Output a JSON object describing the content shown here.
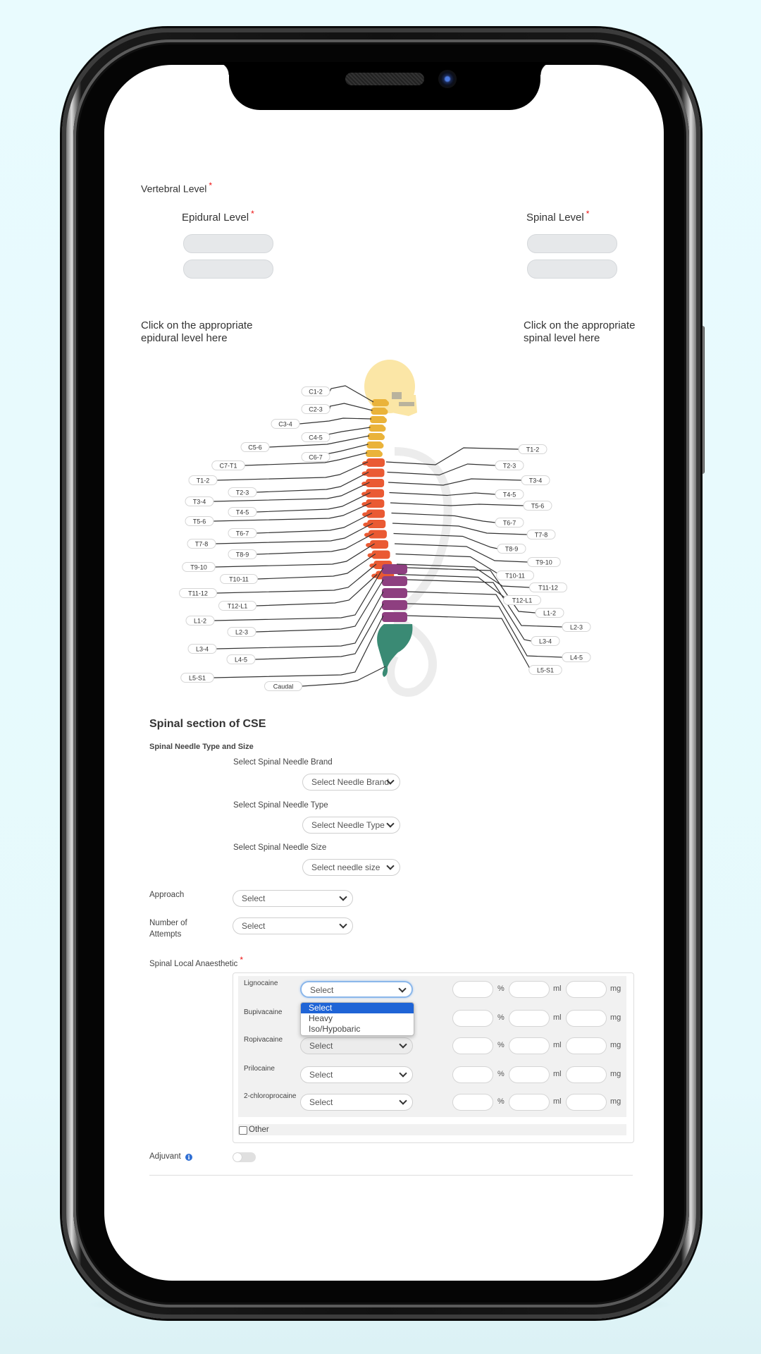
{
  "vertebral_level": {
    "label": "Vertebral Level",
    "required_mark": "*",
    "epidural": {
      "label": "Epidural Level",
      "required_mark": "*",
      "values": [
        "",
        ""
      ]
    },
    "spinal": {
      "label": "Spinal Level",
      "required_mark": "*",
      "values": [
        "",
        ""
      ]
    },
    "epidural_help": [
      "Click on the appropriate",
      "epidural level here"
    ],
    "spinal_help": [
      "Click on the appropriate",
      "spinal level here"
    ]
  },
  "spine_diagram": {
    "left_labels": [
      "C1-2",
      "C2-3",
      "C3-4",
      "C4-5",
      "C5-6",
      "C6-7",
      "C7-T1",
      "T1-2",
      "T2-3",
      "T3-4",
      "T4-5",
      "T5-6",
      "T6-7",
      "T7-8",
      "T8-9",
      "T9-10",
      "T10-11",
      "T11-12",
      "T12-L1",
      "L1-2",
      "L2-3",
      "L3-4",
      "L4-5",
      "L5-S1",
      "Caudal"
    ],
    "right_labels": [
      "T1-2",
      "T2-3",
      "T3-4",
      "T4-5",
      "T5-6",
      "T6-7",
      "T7-8",
      "T8-9",
      "T9-10",
      "T10-11",
      "T11-12",
      "T12-L1",
      "L1-2",
      "L2-3",
      "L3-4",
      "L4-5",
      "L5-S1"
    ],
    "colors": {
      "skull": "#fbe6a6",
      "jaw": "#b9b39d",
      "cervical": "#eab33a",
      "thoracic": "#ea5a33",
      "lumbar": "#8e3f80",
      "sacrum": "#3a8a74",
      "ribcage": "#ececec"
    }
  },
  "spinal_section": {
    "title": "Spinal section of CSE",
    "needle_group_label": "Spinal Needle Type and Size",
    "brand": {
      "label": "Select Spinal Needle Brand",
      "value": "Select Needle Brand"
    },
    "type": {
      "label": "Select Spinal Needle Type",
      "value": "Select Needle Type"
    },
    "size": {
      "label": "Select Spinal Needle Size",
      "value": "Select needle size"
    },
    "approach": {
      "label": "Approach",
      "value": "Select"
    },
    "attempts": {
      "label_line1": "Number of",
      "label_line2": "Attempts",
      "value": "Select"
    },
    "local_anaesthetic": {
      "label": "Spinal Local Anaesthetic",
      "required_mark": "*",
      "rows": [
        {
          "drug": "Lignocaine",
          "value": "Select",
          "percent": "",
          "ml": "",
          "mg": ""
        },
        {
          "drug": "Bupivacaine",
          "value": "Select",
          "percent": "",
          "ml": "",
          "mg": ""
        },
        {
          "drug": "Ropivacaine",
          "value": "Select",
          "percent": "",
          "ml": "",
          "mg": ""
        },
        {
          "drug": "Prilocaine",
          "value": "Select",
          "percent": "",
          "ml": "",
          "mg": ""
        },
        {
          "drug": "2-chloroprocaine",
          "value": "Select",
          "percent": "",
          "ml": "",
          "mg": ""
        }
      ],
      "units": {
        "percent": "%",
        "ml": "ml",
        "mg": "mg"
      },
      "open_dropdown": {
        "options": [
          "Select",
          "Heavy",
          "Iso/Hypobaric"
        ],
        "selected": "Select"
      },
      "other_label": "Other",
      "other_checked": false
    },
    "adjuvant": {
      "label": "Adjuvant",
      "info_glyph": "i",
      "enabled": false
    }
  }
}
